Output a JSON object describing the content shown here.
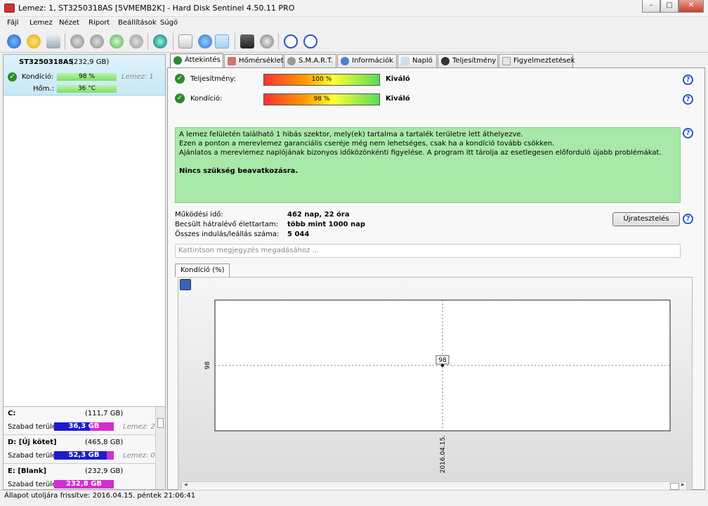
{
  "window": {
    "title": "Lemez: 1, ST3250318AS [5VMEMB2K]  -  Hard Disk Sentinel 4.50.11 PRO",
    "minimize": "–",
    "maximize": "□",
    "close": "✕"
  },
  "menu": [
    "Fájl",
    "Lemez",
    "Nézet",
    "Riport",
    "Beállítások",
    "Súgó"
  ],
  "disk": {
    "name": "ST3250318AS",
    "size": "(232,9 GB)",
    "condition_label": "Kondíció:",
    "condition_value": "98 %",
    "condition_pct": 98,
    "disk_index": "Lemez: 1",
    "temp_label": "Hőm.:",
    "temp_value": "36 °C"
  },
  "partitions": [
    {
      "name": "C:",
      "size": "(111,7 GB)",
      "free_label": "Szabad terület",
      "free": "36,3 GB",
      "disk": "Lemez: 2"
    },
    {
      "name": "D: [Új kötet]",
      "size": "(465,8 GB)",
      "free_label": "Szabad terület",
      "free": "52,3 GB",
      "disk": "Lemez: 0"
    },
    {
      "name": "E: [Blank]",
      "size": "(232,9 GB)",
      "free_label": "Szabad terület",
      "free": "232,8 GB",
      "disk": ""
    }
  ],
  "tabs": [
    "Áttekintés",
    "Hőmérséklet",
    "S.M.A.R.T.",
    "Információk",
    "Napló",
    "Teljesítmény",
    "Figyelmeztetések"
  ],
  "overview": {
    "performance_label": "Teljesítmény:",
    "performance_value": "100 %",
    "performance_rating": "Kiváló",
    "condition_label": "Kondíció:",
    "condition_value": "98 %",
    "condition_rating": "Kiváló",
    "message": [
      "A lemez felületén található 1 hibás szektor, mely(ek) tartalma a tartalék területre lett áthelyezve.",
      "Ezen a ponton a merevlemez garanciális cseréje még nem lehetséges, csak ha a kondíció tovább csökken.",
      "Ajánlatos a merevlemez naplójának bizonyos időközönkénti figyelése. A program itt tárolja az esetlegesen előforduló újabb problémákat."
    ],
    "message_bold": "Nincs szükség beavatkozásra.",
    "uptime_label": "Működési idő:",
    "uptime_value": "462 nap, 22 óra",
    "life_label": "Becsült hátralévő élettartam:",
    "life_value": "több mint 1000 nap",
    "starts_label": "Összes indulás/leállás száma:",
    "starts_value": "5 044",
    "retest_button": "Újratesztelés",
    "note_placeholder": "Kattintson megjegyzés megadásához ..."
  },
  "chart_tab": "Kondíció  (%)",
  "chart_data": {
    "type": "scatter",
    "x": [
      "2016.04.15."
    ],
    "y": [
      98
    ],
    "data_labels": [
      "98"
    ],
    "ytick": "98",
    "xtick": "2016.04.15."
  },
  "status": "Állapot utoljára frissítve: 2016.04.15. péntek 21:06:41",
  "colors": {
    "selected_bg": "#d3edf9",
    "message_bg": "#a8e8a8",
    "bar_green": "#7fdc6b",
    "free_blue": "#1c1ccf",
    "free_magenta": "#d02fd0"
  }
}
